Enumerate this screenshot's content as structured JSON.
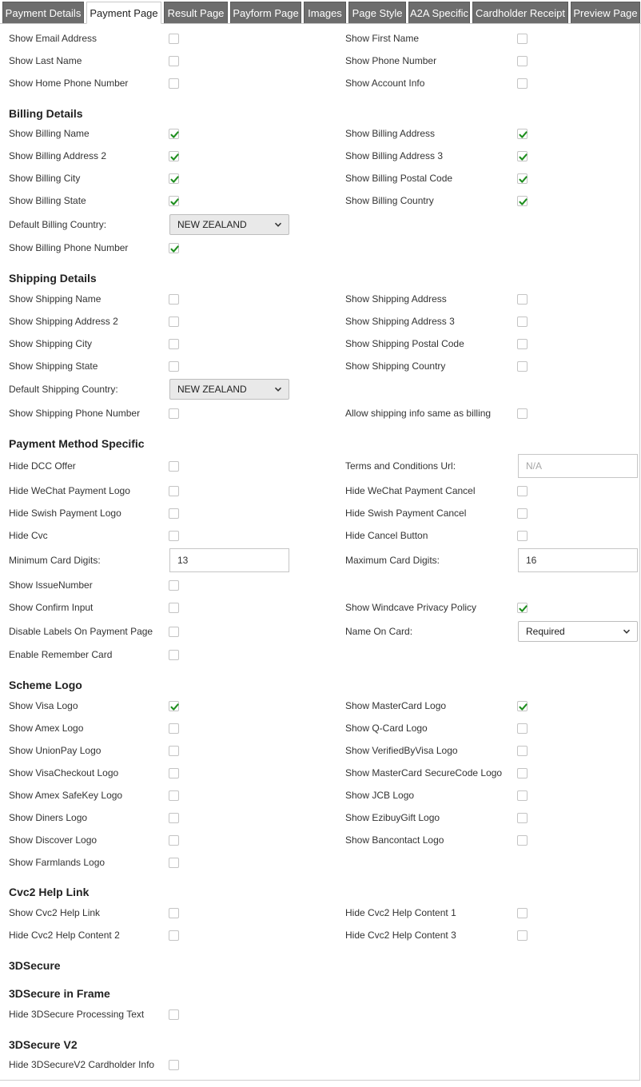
{
  "tabs": [
    {
      "label": "Payment Details",
      "active": false
    },
    {
      "label": "Payment Page",
      "active": true
    },
    {
      "label": "Result Page",
      "active": false
    },
    {
      "label": "Payform Page",
      "active": false
    },
    {
      "label": "Images",
      "active": false
    },
    {
      "label": "Page Style",
      "active": false
    },
    {
      "label": "A2A Specific",
      "active": false
    },
    {
      "label": "Cardholder Receipt",
      "active": false
    },
    {
      "label": "Preview Page",
      "active": false
    }
  ],
  "general": [
    {
      "label": "Show Email Address",
      "checked": false
    },
    {
      "label": "Show First Name",
      "checked": false
    },
    {
      "label": "Show Last Name",
      "checked": false
    },
    {
      "label": "Show Phone Number",
      "checked": false
    },
    {
      "label": "Show Home Phone Number",
      "checked": false
    },
    {
      "label": "Show Account Info",
      "checked": false
    }
  ],
  "billing": {
    "title": "Billing Details",
    "items": [
      {
        "label": "Show Billing Name",
        "checked": true
      },
      {
        "label": "Show Billing Address",
        "checked": true
      },
      {
        "label": "Show Billing Address 2",
        "checked": true
      },
      {
        "label": "Show Billing Address 3",
        "checked": true
      },
      {
        "label": "Show Billing City",
        "checked": true
      },
      {
        "label": "Show Billing Postal Code",
        "checked": true
      },
      {
        "label": "Show Billing State",
        "checked": true
      },
      {
        "label": "Show Billing Country",
        "checked": true
      }
    ],
    "default_country_label": "Default Billing Country:",
    "default_country_value": "NEW ZEALAND",
    "phone": {
      "label": "Show Billing Phone Number",
      "checked": true
    }
  },
  "shipping": {
    "title": "Shipping Details",
    "items": [
      {
        "label": "Show Shipping Name",
        "checked": false
      },
      {
        "label": "Show Shipping Address",
        "checked": false
      },
      {
        "label": "Show Shipping Address 2",
        "checked": false
      },
      {
        "label": "Show Shipping Address 3",
        "checked": false
      },
      {
        "label": "Show Shipping City",
        "checked": false
      },
      {
        "label": "Show Shipping Postal Code",
        "checked": false
      },
      {
        "label": "Show Shipping State",
        "checked": false
      },
      {
        "label": "Show Shipping Country",
        "checked": false
      }
    ],
    "default_country_label": "Default Shipping Country:",
    "default_country_value": "NEW ZEALAND",
    "phone": {
      "label": "Show Shipping Phone Number",
      "checked": false
    },
    "same_as_billing": {
      "label": "Allow shipping info same as billing",
      "checked": false
    }
  },
  "payment_method": {
    "title": "Payment Method Specific",
    "hide_dcc": {
      "label": "Hide DCC Offer",
      "checked": false
    },
    "terms_label": "Terms and Conditions Url:",
    "terms_placeholder": "N/A",
    "wechat_logo": {
      "label": "Hide WeChat Payment Logo",
      "checked": false
    },
    "wechat_cancel": {
      "label": "Hide WeChat Payment Cancel",
      "checked": false
    },
    "swish_logo": {
      "label": "Hide Swish Payment Logo",
      "checked": false
    },
    "swish_cancel": {
      "label": "Hide Swish Payment Cancel",
      "checked": false
    },
    "hide_cvc": {
      "label": "Hide Cvc",
      "checked": false
    },
    "hide_cancel": {
      "label": "Hide Cancel Button",
      "checked": false
    },
    "min_digits_label": "Minimum Card Digits:",
    "min_digits_value": "13",
    "max_digits_label": "Maximum Card Digits:",
    "max_digits_value": "16",
    "issue_number": {
      "label": "Show IssueNumber",
      "checked": false
    },
    "confirm_input": {
      "label": "Show Confirm Input",
      "checked": false
    },
    "privacy_policy": {
      "label": "Show Windcave Privacy Policy",
      "checked": true
    },
    "disable_labels": {
      "label": "Disable Labels On Payment Page",
      "checked": false
    },
    "name_on_card_label": "Name On Card:",
    "name_on_card_value": "Required",
    "remember_card": {
      "label": "Enable Remember Card",
      "checked": false
    }
  },
  "scheme_logo": {
    "title": "Scheme Logo",
    "items": [
      {
        "label": "Show Visa Logo",
        "checked": true
      },
      {
        "label": "Show MasterCard Logo",
        "checked": true
      },
      {
        "label": "Show Amex Logo",
        "checked": false
      },
      {
        "label": "Show Q-Card Logo",
        "checked": false
      },
      {
        "label": "Show UnionPay Logo",
        "checked": false
      },
      {
        "label": "Show VerifiedByVisa Logo",
        "checked": false
      },
      {
        "label": "Show VisaCheckout Logo",
        "checked": false
      },
      {
        "label": "Show MasterCard SecureCode Logo",
        "checked": false
      },
      {
        "label": "Show Amex SafeKey Logo",
        "checked": false
      },
      {
        "label": "Show JCB Logo",
        "checked": false
      },
      {
        "label": "Show Diners Logo",
        "checked": false
      },
      {
        "label": "Show EzibuyGift Logo",
        "checked": false
      },
      {
        "label": "Show Discover Logo",
        "checked": false
      },
      {
        "label": "Show Bancontact Logo",
        "checked": false
      },
      {
        "label": "Show Farmlands Logo",
        "checked": false
      }
    ]
  },
  "cvc2": {
    "title": "Cvc2 Help Link",
    "items": [
      {
        "label": "Show Cvc2 Help Link",
        "checked": false
      },
      {
        "label": "Hide Cvc2 Help Content 1",
        "checked": false
      },
      {
        "label": "Hide Cvc2 Help Content 2",
        "checked": false
      },
      {
        "label": "Hide Cvc2 Help Content 3",
        "checked": false
      }
    ]
  },
  "three_d_secure": {
    "title": "3DSecure"
  },
  "three_d_frame": {
    "title": "3DSecure in Frame",
    "hide_processing": {
      "label": "Hide 3DSecure Processing Text",
      "checked": false
    }
  },
  "three_d_v2": {
    "title": "3DSecure V2",
    "hide_cardholder": {
      "label": "Hide 3DSecureV2 Cardholder Info",
      "checked": false
    }
  },
  "colors": {
    "check": "#1f8f1f",
    "tab_bg": "#6d6d6d",
    "tab_text": "#ffffff"
  }
}
